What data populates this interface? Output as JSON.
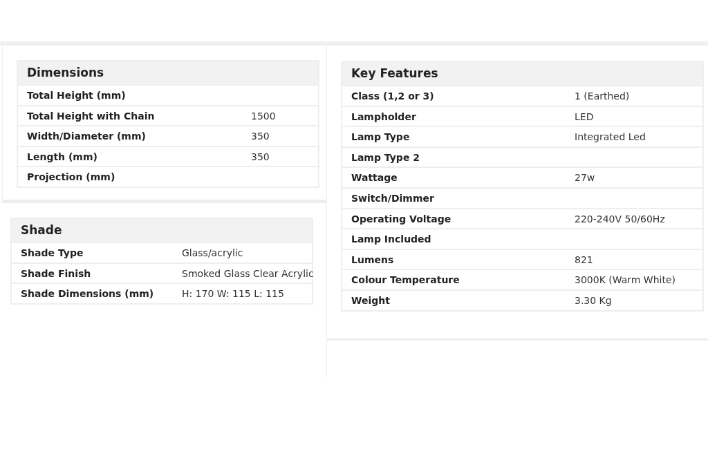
{
  "left_column": {
    "dimensions": {
      "title": "Dimensions",
      "rows": [
        {
          "label": "Total Height (mm)"
        },
        {
          "label": "Total Height with Chain",
          "value": "1500"
        },
        {
          "label": "Width/Diameter (mm)",
          "value": "350"
        },
        {
          "label": "Length (mm)",
          "value": "350"
        },
        {
          "label": "Projection (mm)"
        }
      ]
    },
    "shade": {
      "title": "Shade",
      "rows": [
        {
          "label": "Shade Type",
          "value": "Glass/acrylic"
        },
        {
          "label": "Shade Finish",
          "value": "Smoked Glass Clear Acrylic"
        },
        {
          "label": "Shade Dimensions (mm)",
          "value": "H: 170 W: 115 L: 115"
        }
      ]
    }
  },
  "right_column": {
    "key_features": {
      "title": "Key Features",
      "rows": [
        {
          "label": "Class (1,2 or 3)",
          "value": "1 (Earthed)"
        },
        {
          "label": "Lampholder",
          "value": "LED"
        },
        {
          "label": "Lamp Type",
          "value": "Integrated Led"
        },
        {
          "label": "Lamp Type 2"
        },
        {
          "label": "Wattage",
          "value": "27w"
        },
        {
          "label": "Switch/Dimmer"
        },
        {
          "label": "Operating Voltage",
          "value": "220-240V 50/60Hz"
        },
        {
          "label": "Lamp Included"
        },
        {
          "label": "Lumens",
          "value": "821"
        },
        {
          "label": "Colour Temperature",
          "value": "3000K (Warm White)"
        },
        {
          "label": "Weight",
          "value": "3.30 Kg"
        }
      ]
    }
  }
}
